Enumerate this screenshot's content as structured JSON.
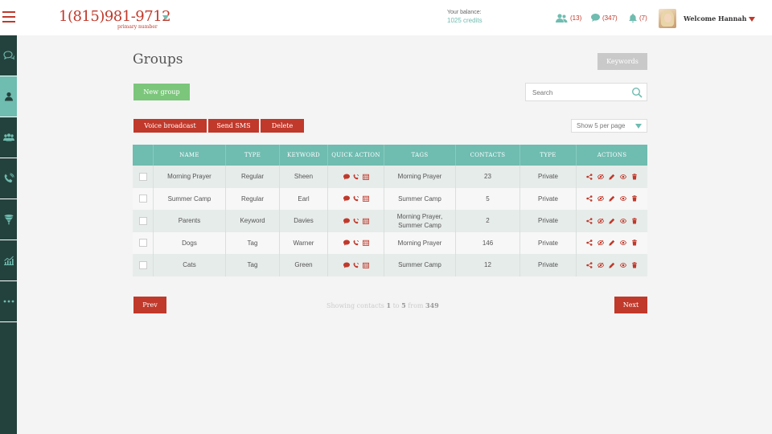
{
  "header": {
    "phone": "1(815)981-9712",
    "phone_sublabel": "primary number",
    "balance_label": "Your balance:",
    "balance_value": "1025 credits",
    "contacts_count": "(13)",
    "messages_count": "(347)",
    "notifications_count": "(7)",
    "welcome": "Welcome Hannah"
  },
  "sidebar": {
    "items": [
      {
        "icon": "chat-icon"
      },
      {
        "icon": "user-icon",
        "active": true
      },
      {
        "icon": "groups-icon"
      },
      {
        "icon": "phone-icon"
      },
      {
        "icon": "funnel-icon"
      },
      {
        "icon": "chart-icon"
      },
      {
        "icon": "more-icon"
      }
    ]
  },
  "page": {
    "title": "Groups",
    "keywords_button": "Keywords",
    "new_group_button": "New group",
    "search_placeholder": "Search",
    "voice_broadcast_button": "Voice broadcast",
    "send_sms_button": "Send SMS",
    "delete_button": "Delete",
    "per_page": "Show 5 per page"
  },
  "table": {
    "columns": [
      "NAME",
      "TYPE",
      "KEYWORD",
      "QUICK ACTION",
      "TAGS",
      "CONTACTS",
      "TYPE",
      "ACTIONS"
    ],
    "rows": [
      {
        "name": "Morning Prayer",
        "type": "Regular",
        "keyword": "Sheen",
        "tags": "Morning Prayer",
        "contacts": "23",
        "privacy": "Private"
      },
      {
        "name": "Summer Camp",
        "type": "Regular",
        "keyword": "Earl",
        "tags": "Summer Camp",
        "contacts": "5",
        "privacy": "Private"
      },
      {
        "name": "Parents",
        "type": "Keyword",
        "keyword": "Davies",
        "tags": "Morning Prayer,\nSummer Camp",
        "contacts": "2",
        "privacy": "Private"
      },
      {
        "name": "Dogs",
        "type": "Tag",
        "keyword": "Warner",
        "tags": "Morning Prayer",
        "contacts": "146",
        "privacy": "Private"
      },
      {
        "name": "Cats",
        "type": "Tag",
        "keyword": "Green",
        "tags": "Summer Camp",
        "contacts": "12",
        "privacy": "Private"
      }
    ]
  },
  "pagination": {
    "prev": "Prev",
    "next": "Next",
    "showing_prefix": "Showing contacts",
    "from_index": "1",
    "to_word": "to",
    "to_index": "5",
    "from_word": "from",
    "total": "349"
  },
  "colors": {
    "accent_red": "#c0392b",
    "teal": "#6fbcb0",
    "sidebar_bg": "#24423d",
    "green": "#7bc67b"
  }
}
